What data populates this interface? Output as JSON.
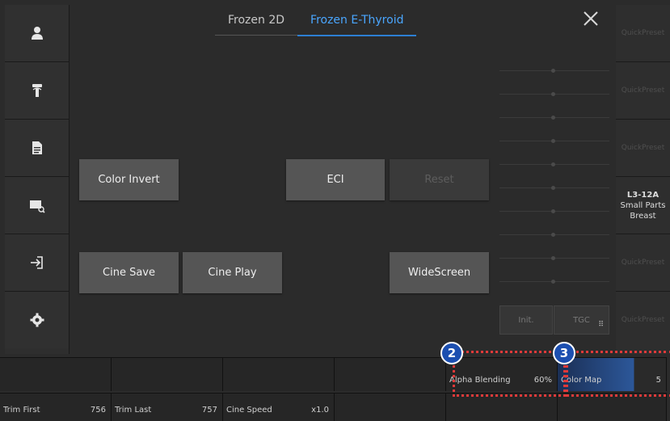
{
  "tabs": [
    {
      "label": "Frozen 2D",
      "active": false
    },
    {
      "label": "Frozen E-Thyroid",
      "active": true
    }
  ],
  "sidebar": {
    "icons": [
      "user-icon",
      "probe-icon",
      "document-icon",
      "image-zoom-icon",
      "exit-icon",
      "gear-icon"
    ]
  },
  "buttons": {
    "color_invert": "Color Invert",
    "eci": "ECI",
    "reset": "Reset",
    "cine_save": "Cine Save",
    "cine_play": "Cine Play",
    "widescreen": "WideScreen"
  },
  "tgc": {
    "init_label": "Init.",
    "tgc_label": "TGC"
  },
  "presets": {
    "quick_label": "QuickPreset",
    "selected": {
      "probe": "L3-12A",
      "app": "Small Parts",
      "preset": "Breast"
    }
  },
  "bottom_row1": {
    "alpha_blending": {
      "label": "Alpha Blending",
      "value": "60%"
    },
    "color_map": {
      "label": "Color Map",
      "value": "5"
    }
  },
  "bottom_row2": {
    "trim_first": {
      "label": "Trim First",
      "value": "756"
    },
    "trim_last": {
      "label": "Trim Last",
      "value": "757"
    },
    "cine_speed": {
      "label": "Cine Speed",
      "value": "x1.0"
    }
  },
  "callouts": {
    "a": "2",
    "b": "3"
  },
  "colors": {
    "accent": "#4aa6ff",
    "callout": "#e03a3a",
    "badge": "#1c4fb0"
  }
}
